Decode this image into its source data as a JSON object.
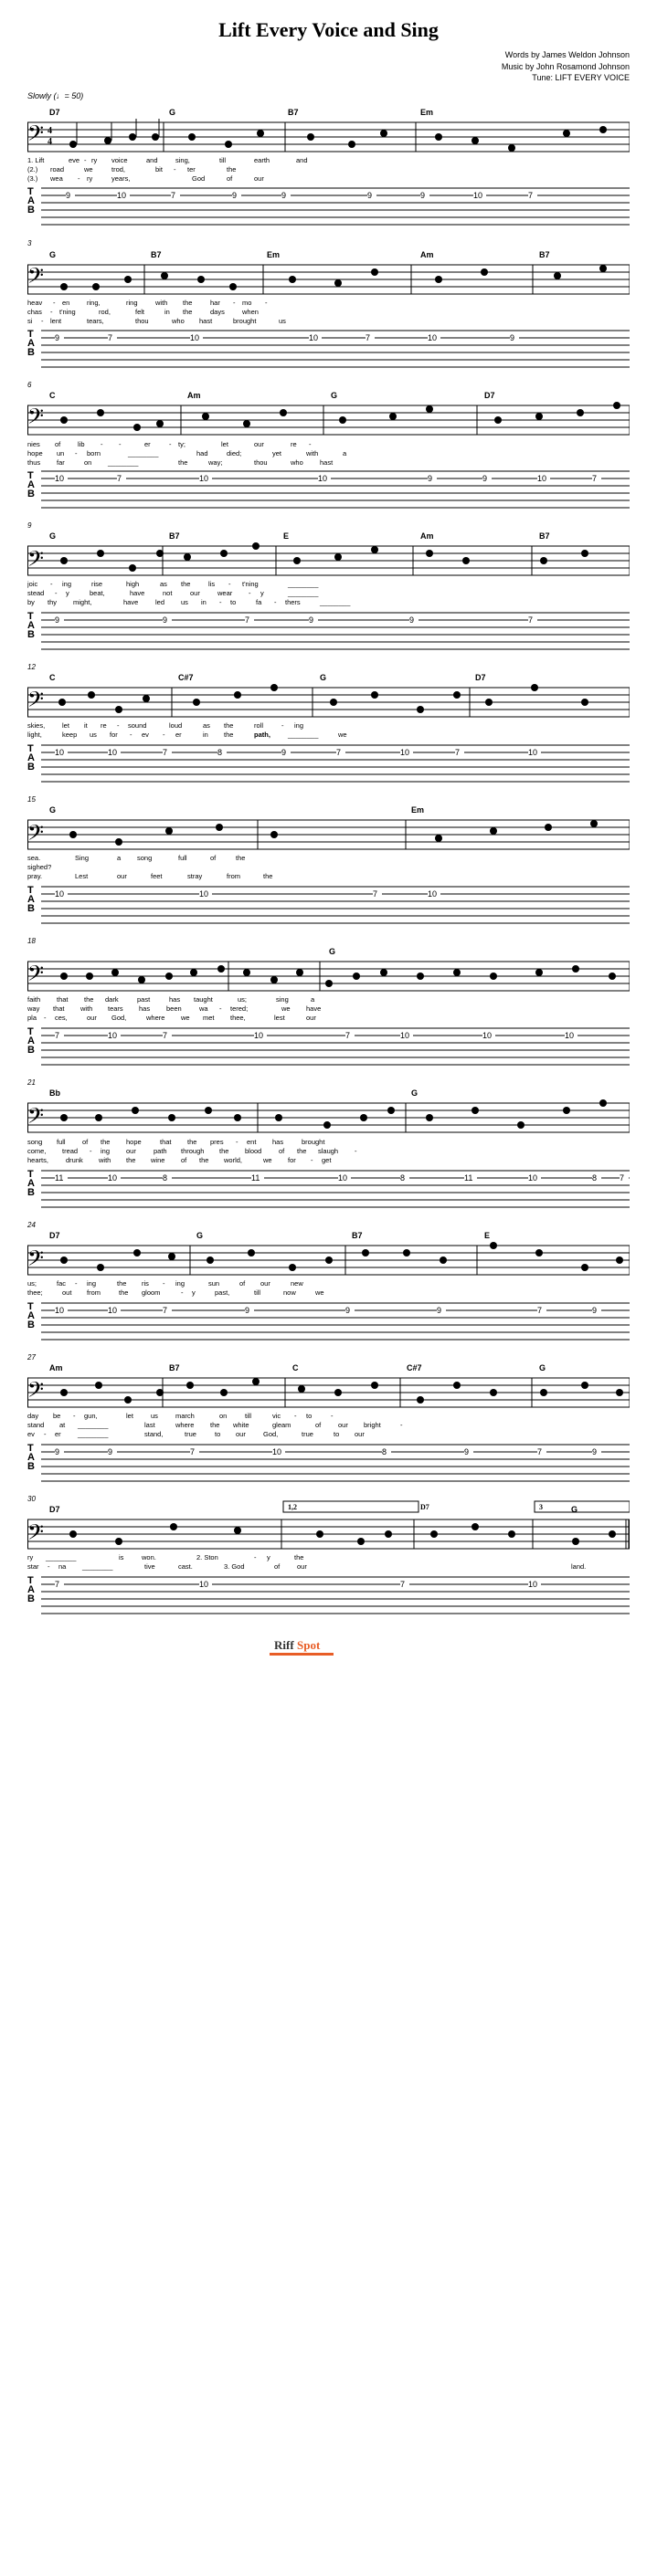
{
  "title": "Lift Every Voice and Sing",
  "credits": {
    "words": "Words by James Weldon Johnson",
    "music": "Music by John Rosamond Johnson",
    "tune": "Tune: LIFT EVERY VOICE"
  },
  "tempo": {
    "marking": "Slowly",
    "bpm": 50
  },
  "logo": {
    "text": "RiffSpot",
    "riff": "Riff",
    "spot": "Spot"
  },
  "systems": [
    {
      "measureStart": 1,
      "chords": [
        "D7",
        "G",
        "B7",
        "Em"
      ],
      "lyrics": [
        [
          "1. Lift",
          "eve",
          "-",
          "ry",
          "voice",
          "and",
          "sing,",
          "till",
          "earth",
          "and"
        ],
        [
          "(2.)",
          "road",
          "we",
          "trod,",
          "bit",
          "-",
          "ter",
          "the"
        ],
        [
          "(3.)",
          "wea",
          "-",
          "ry",
          "years,",
          "God",
          "of",
          "our"
        ]
      ],
      "tabNumbers": [
        {
          "string": 1,
          "pos": 50,
          "fret": "9"
        },
        {
          "string": 1,
          "pos": 110,
          "fret": "10"
        },
        {
          "string": 1,
          "pos": 170,
          "fret": "7"
        },
        {
          "string": 1,
          "pos": 230,
          "fret": "9"
        },
        {
          "string": 1,
          "pos": 290,
          "fret": "9"
        },
        {
          "string": 1,
          "pos": 380,
          "fret": "9"
        },
        {
          "string": 1,
          "pos": 440,
          "fret": "9"
        },
        {
          "string": 1,
          "pos": 500,
          "fret": "10"
        },
        {
          "string": 1,
          "pos": 560,
          "fret": "7"
        }
      ]
    },
    {
      "measureStart": 3,
      "chords": [
        "G",
        "B7",
        "Em",
        "Am",
        "B7"
      ],
      "lyrics": [
        [
          "heav",
          "-",
          "en",
          "ring,",
          "ring",
          "with",
          "the",
          "har",
          "-",
          "mo",
          "-"
        ],
        [
          "chas",
          "-",
          "t'ning",
          "rod,",
          "felt",
          "in",
          "the",
          "days",
          "when"
        ],
        [
          "si",
          "-",
          "lent",
          "tears,",
          "thou",
          "who",
          "hast",
          "brought",
          "us"
        ]
      ],
      "tabNumbers": [
        {
          "string": 1,
          "pos": 50,
          "fret": "9"
        },
        {
          "string": 1,
          "pos": 110,
          "fret": "7"
        },
        {
          "string": 1,
          "pos": 200,
          "fret": "10"
        },
        {
          "string": 1,
          "pos": 320,
          "fret": "10"
        },
        {
          "string": 1,
          "pos": 380,
          "fret": "7"
        },
        {
          "string": 1,
          "pos": 440,
          "fret": "10"
        },
        {
          "string": 1,
          "pos": 530,
          "fret": "9"
        }
      ]
    },
    {
      "measureStart": 6,
      "chords": [
        "C",
        "Am",
        "G",
        "D7"
      ],
      "lyrics": [
        [
          "nies",
          "of",
          "lib",
          "-",
          "-",
          "er",
          "-",
          "ty;",
          "let",
          "our",
          "re",
          "-"
        ],
        [
          "hope",
          "un",
          "-",
          "born",
          "________",
          "had",
          "died;",
          "yet",
          "with",
          "a"
        ],
        [
          "thus",
          "far",
          "on",
          "________",
          "the",
          "way;",
          "thou",
          "who",
          "hast"
        ]
      ],
      "tabNumbers": [
        {
          "string": 1,
          "pos": 50,
          "fret": "10"
        },
        {
          "string": 1,
          "pos": 110,
          "fret": "7"
        },
        {
          "string": 1,
          "pos": 200,
          "fret": "10"
        },
        {
          "string": 1,
          "pos": 320,
          "fret": "10"
        },
        {
          "string": 1,
          "pos": 440,
          "fret": "9"
        },
        {
          "string": 1,
          "pos": 500,
          "fret": "9"
        },
        {
          "string": 1,
          "pos": 560,
          "fret": "10"
        },
        {
          "string": 1,
          "pos": 620,
          "fret": "7"
        }
      ]
    },
    {
      "measureStart": 9,
      "chords": [
        "G",
        "B7",
        "E",
        "Am",
        "B7"
      ],
      "lyrics": [
        [
          "joic",
          "-",
          "ing",
          "rise",
          "high",
          "as",
          "the",
          "lis",
          "-",
          "t'ning",
          "________"
        ],
        [
          "stead",
          "-",
          "y",
          "beat,",
          "have",
          "not",
          "our",
          "wear",
          "-",
          "y",
          "________"
        ],
        [
          "by",
          "thy",
          "might,",
          "have",
          "led",
          "us",
          "in",
          "-",
          "to",
          "fa",
          "-",
          "thers",
          "________"
        ]
      ],
      "tabNumbers": [
        {
          "string": 1,
          "pos": 50,
          "fret": "9"
        },
        {
          "string": 1,
          "pos": 150,
          "fret": "9"
        },
        {
          "string": 1,
          "pos": 240,
          "fret": "7"
        },
        {
          "string": 1,
          "pos": 310,
          "fret": "9"
        },
        {
          "string": 1,
          "pos": 410,
          "fret": "9"
        },
        {
          "string": 1,
          "pos": 500,
          "fret": "7"
        }
      ]
    },
    {
      "measureStart": 12,
      "chords": [
        "C",
        "C#7",
        "G",
        "D7"
      ],
      "lyrics": [
        [
          "skies,",
          "let",
          "it",
          "re",
          "-",
          "sound",
          "loud",
          "as",
          "the",
          "roll",
          "-",
          "ing"
        ],
        [
          "light,",
          "keep",
          "us",
          "for",
          "-",
          "ev",
          "-",
          "er",
          "in",
          "the",
          "path,",
          "________",
          "we"
        ]
      ],
      "tabNumbers": [
        {
          "string": 1,
          "pos": 50,
          "fret": "10"
        },
        {
          "string": 1,
          "pos": 100,
          "fret": "10"
        },
        {
          "string": 1,
          "pos": 150,
          "fret": "7"
        },
        {
          "string": 1,
          "pos": 200,
          "fret": "8"
        },
        {
          "string": 1,
          "pos": 270,
          "fret": "9"
        },
        {
          "string": 1,
          "pos": 340,
          "fret": "7"
        },
        {
          "string": 1,
          "pos": 410,
          "fret": "10"
        },
        {
          "string": 1,
          "pos": 480,
          "fret": "7"
        },
        {
          "string": 1,
          "pos": 560,
          "fret": "10"
        }
      ]
    },
    {
      "measureStart": 15,
      "chords": [
        "G",
        "",
        "Em"
      ],
      "lyrics": [
        [
          "sea.",
          "Sing",
          "a",
          "song",
          "full",
          "of",
          "the"
        ],
        [
          "sighed?",
          "",
          "",
          "",
          "",
          "",
          ""
        ],
        [
          "pray.",
          "Lest",
          "our",
          "feet",
          "stray",
          "from",
          "the"
        ]
      ],
      "tabNumbers": [
        {
          "string": 1,
          "pos": 50,
          "fret": "10"
        },
        {
          "string": 1,
          "pos": 200,
          "fret": "10"
        },
        {
          "string": 1,
          "pos": 380,
          "fret": "7"
        },
        {
          "string": 1,
          "pos": 440,
          "fret": "10"
        }
      ]
    },
    {
      "measureStart": 18,
      "chords": [
        "",
        "G"
      ],
      "lyrics": [
        [
          "faith",
          "that",
          "the",
          "dark",
          "past",
          "has",
          "taught",
          "us;",
          "sing",
          "a"
        ],
        [
          "way",
          "that",
          "with",
          "tears",
          "has",
          "been",
          "wa",
          "-",
          "tered;",
          "we",
          "have"
        ],
        [
          "pla",
          "-",
          "ces,",
          "our",
          "God,",
          "where",
          "we",
          "met",
          "thee,",
          "lest",
          "our"
        ]
      ],
      "tabNumbers": [
        {
          "string": 1,
          "pos": 50,
          "fret": "7"
        },
        {
          "string": 1,
          "pos": 110,
          "fret": "10"
        },
        {
          "string": 1,
          "pos": 170,
          "fret": "7"
        },
        {
          "string": 1,
          "pos": 260,
          "fret": "10"
        },
        {
          "string": 1,
          "pos": 350,
          "fret": "7"
        },
        {
          "string": 1,
          "pos": 410,
          "fret": "10"
        },
        {
          "string": 1,
          "pos": 500,
          "fret": "10"
        },
        {
          "string": 1,
          "pos": 590,
          "fret": "10"
        }
      ]
    },
    {
      "measureStart": 21,
      "chords": [
        "Bb",
        "",
        "G"
      ],
      "lyrics": [
        [
          "song",
          "full",
          "of",
          "the",
          "hope",
          "that",
          "the",
          "pres",
          "-",
          "ent",
          "has",
          "brought"
        ],
        [
          "come,",
          "tread",
          "-",
          "ing",
          "our",
          "path",
          "through",
          "the",
          "blood",
          "of",
          "the",
          "slaugh",
          "-"
        ],
        [
          "hearts,",
          "drunk",
          "with",
          "the",
          "wine",
          "of",
          "the",
          "world,",
          "we",
          "for",
          "-",
          "get"
        ]
      ],
      "tabNumbers": [
        {
          "string": 1,
          "pos": 50,
          "fret": "11"
        },
        {
          "string": 1,
          "pos": 110,
          "fret": "10"
        },
        {
          "string": 1,
          "pos": 170,
          "fret": "8"
        },
        {
          "string": 1,
          "pos": 260,
          "fret": "11"
        },
        {
          "string": 1,
          "pos": 350,
          "fret": "10"
        },
        {
          "string": 1,
          "pos": 410,
          "fret": "8"
        },
        {
          "string": 1,
          "pos": 480,
          "fret": "11"
        },
        {
          "string": 1,
          "pos": 540,
          "fret": "10"
        },
        {
          "string": 1,
          "pos": 600,
          "fret": "8"
        },
        {
          "string": 1,
          "pos": 650,
          "fret": "7"
        }
      ]
    },
    {
      "measureStart": 24,
      "chords": [
        "D7",
        "G",
        "B7",
        "E"
      ],
      "lyrics": [
        [
          "us;",
          "fac",
          "-",
          "ing",
          "the",
          "ris",
          "-",
          "ing",
          "sun",
          "of",
          "our",
          "new"
        ],
        [
          "thee;",
          "out",
          "from",
          "the",
          "gloom",
          "-",
          "y",
          "past,",
          "till",
          "now",
          "we"
        ],
        [
          ""
        ]
      ],
      "tabNumbers": [
        {
          "string": 1,
          "pos": 50,
          "fret": "10"
        },
        {
          "string": 1,
          "pos": 110,
          "fret": "10"
        },
        {
          "string": 1,
          "pos": 170,
          "fret": "7"
        },
        {
          "string": 1,
          "pos": 260,
          "fret": "9"
        },
        {
          "string": 1,
          "pos": 350,
          "fret": "9"
        },
        {
          "string": 1,
          "pos": 450,
          "fret": "9"
        },
        {
          "string": 1,
          "pos": 550,
          "fret": "7"
        },
        {
          "string": 1,
          "pos": 620,
          "fret": "9"
        }
      ]
    },
    {
      "measureStart": 27,
      "chords": [
        "Am",
        "B7",
        "C",
        "C#7",
        "G"
      ],
      "lyrics": [
        [
          "day",
          "be",
          "-",
          "gun,",
          "let",
          "us",
          "march",
          "on",
          "till",
          "vic",
          "-",
          "to",
          "-"
        ],
        [
          "stand",
          "at",
          "________",
          "last",
          "where",
          "the",
          "white",
          "gleam",
          "of",
          "our",
          "bright",
          "-"
        ],
        [
          "ev",
          "-",
          "er",
          "________",
          "stand,",
          "true",
          "to",
          "our",
          "God,",
          "true",
          "to",
          "our"
        ]
      ],
      "tabNumbers": [
        {
          "string": 1,
          "pos": 50,
          "fret": "9"
        },
        {
          "string": 1,
          "pos": 110,
          "fret": "9"
        },
        {
          "string": 1,
          "pos": 200,
          "fret": "7"
        },
        {
          "string": 1,
          "pos": 290,
          "fret": "10"
        },
        {
          "string": 1,
          "pos": 380,
          "fret": "8"
        },
        {
          "string": 1,
          "pos": 470,
          "fret": "9"
        },
        {
          "string": 1,
          "pos": 560,
          "fret": "7"
        },
        {
          "string": 1,
          "pos": 620,
          "fret": "9"
        }
      ]
    },
    {
      "measureStart": 30,
      "chords": [
        "D7",
        "[1,2]",
        "D7",
        "[3]",
        "G"
      ],
      "lyrics": [
        [
          "ry",
          "________",
          "is",
          "won.",
          "2. Ston",
          "-",
          "y",
          "the"
        ],
        [
          "star",
          "-",
          "na",
          "________",
          "tive",
          "cast.",
          "3. God",
          "of",
          "our"
        ],
        [
          ""
        ]
      ],
      "tabNumbers": [
        {
          "string": 1,
          "pos": 50,
          "fret": "7"
        },
        {
          "string": 1,
          "pos": 200,
          "fret": "10"
        },
        {
          "string": 1,
          "pos": 380,
          "fret": "7"
        },
        {
          "string": 1,
          "pos": 500,
          "fret": "10"
        }
      ]
    }
  ]
}
